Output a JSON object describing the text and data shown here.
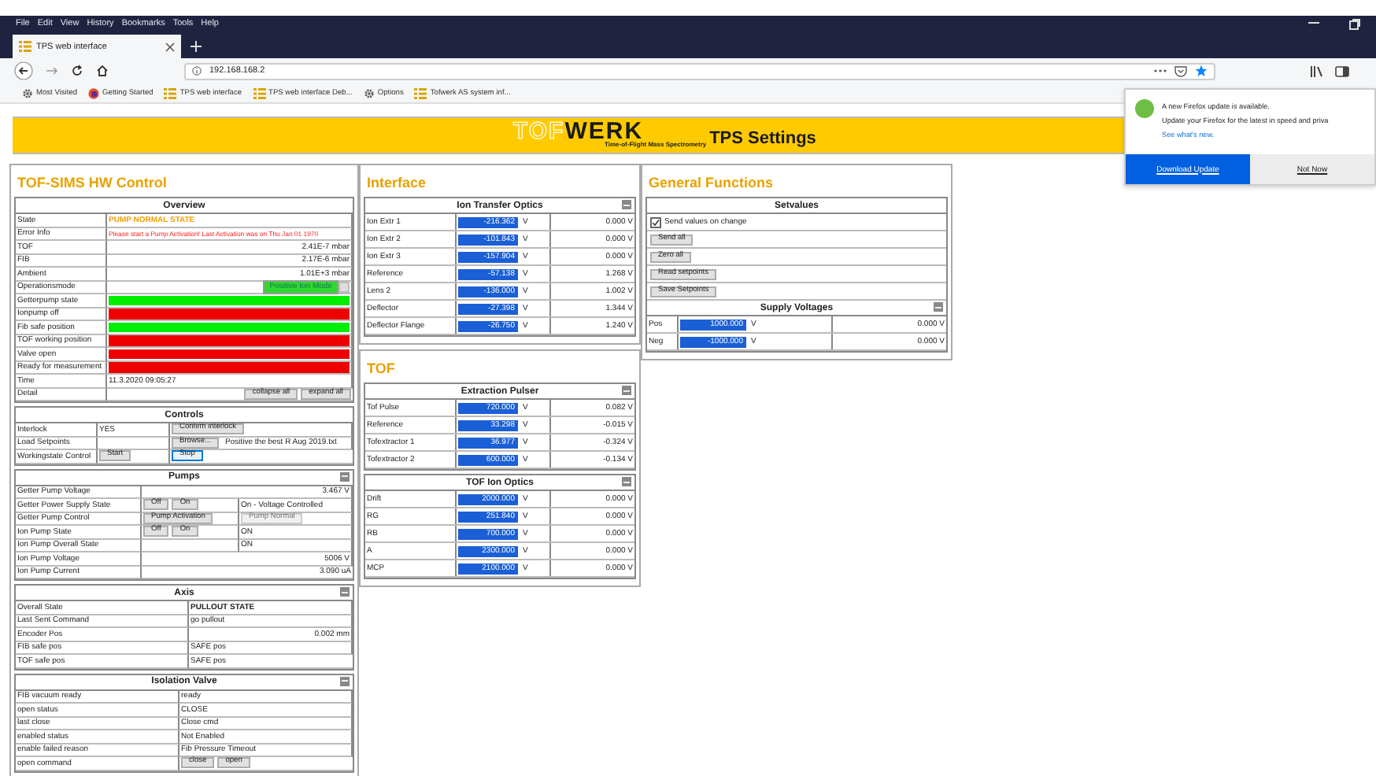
{
  "browser": {
    "menu": [
      "File",
      "Edit",
      "View",
      "History",
      "Bookmarks",
      "Tools",
      "Help"
    ],
    "tab": {
      "title": "TPS web interface"
    },
    "address": "192.168.168.2",
    "bookmarks": [
      {
        "label": "Most Visited",
        "kind": "gear"
      },
      {
        "label": "Getting Started",
        "kind": "globe"
      },
      {
        "label": "TPS web interface",
        "kind": "grid"
      },
      {
        "label": "TPS web interface Deb...",
        "kind": "grid"
      },
      {
        "label": "Options",
        "kind": "gear"
      },
      {
        "label": "Tofwerk AS system inf...",
        "kind": "grid"
      }
    ]
  },
  "banner": {
    "logo_outline": "TOF",
    "logo_bold": "WERK",
    "tagline": "Time-of-Flight Mass Spectrometry",
    "title": "TPS Settings"
  },
  "update_popup": {
    "heading": "A new Firefox update is available.",
    "message": "Update your Firefox for the latest in speed and priva",
    "link": "See what's new.",
    "buttons": [
      {
        "label": "Download Update",
        "kind": "primary"
      },
      {
        "label": "Not Now",
        "kind": "secondary"
      }
    ]
  },
  "control_panel": {
    "title": "TOF-SIMS HW Control",
    "sections": [
      {
        "title": "Overview",
        "kind": "overview",
        "collapsible": false,
        "rows": [
          {
            "label": "State",
            "cells": [
              {
                "kind": "warning-text",
                "text": "PUMP NORMAL STATE"
              }
            ]
          },
          {
            "label": "Error Info",
            "cells": [
              {
                "kind": "error-text",
                "text": "Please start a Pump Activation! Last Activation was on Thu Jan 01 1970"
              }
            ]
          },
          {
            "label": "TOF",
            "cells": [
              {
                "kind": "number",
                "text": "2.41E-7 mbar"
              }
            ]
          },
          {
            "label": "FIB",
            "cells": [
              {
                "kind": "number",
                "text": "2.17E-6 mbar"
              }
            ]
          },
          {
            "label": "Ambient",
            "cells": [
              {
                "kind": "number",
                "text": "1.01E+3 mbar"
              }
            ]
          },
          {
            "label": "Operationsmode",
            "cells": [
              {
                "kind": "select",
                "text": "Positive Ion Mode"
              }
            ]
          },
          {
            "label": "Getterpump state",
            "cells": [
              {
                "kind": "bar",
                "color": "#00ee00"
              }
            ]
          },
          {
            "label": "Ionpump off",
            "cells": [
              {
                "kind": "bar",
                "color": "#ee0000"
              }
            ]
          },
          {
            "label": "Fib safe position",
            "cells": [
              {
                "kind": "bar",
                "color": "#00ee00"
              }
            ]
          },
          {
            "label": "TOF working position",
            "cells": [
              {
                "kind": "bar",
                "color": "#ee0000"
              }
            ]
          },
          {
            "label": "Valve open",
            "cells": [
              {
                "kind": "bar",
                "color": "#ee0000"
              }
            ]
          },
          {
            "label": "Ready for measurement",
            "cells": [
              {
                "kind": "bar",
                "color": "#ee0000"
              }
            ]
          },
          {
            "label": "Time",
            "cells": [
              {
                "kind": "text",
                "text": "11.3.2020 09:05:27"
              }
            ]
          },
          {
            "label": "Detail",
            "cells": [
              {
                "kind": "buttons",
                "buttons": [
                  {
                    "label": "collapse all",
                    "disabled": false,
                    "focused": false
                  },
                  {
                    "label": "expand all",
                    "disabled": false,
                    "focused": false
                  }
                ]
              }
            ]
          }
        ]
      },
      {
        "title": "Controls",
        "kind": "controls",
        "collapsible": false,
        "rows": [
          {
            "label": "Interlock",
            "cells": [
              {
                "kind": "text",
                "text": "YES"
              },
              {
                "kind": "buttons",
                "buttons": [
                  {
                    "label": "Confirm interlock",
                    "disabled": false,
                    "focused": false
                  }
                ]
              }
            ]
          },
          {
            "label": "Load Setpoints",
            "cells": [
              {
                "kind": "blank"
              },
              {
                "kind": "file",
                "button": "Browse...",
                "text": "Positive the best R Aug 2019.txt"
              }
            ]
          },
          {
            "label": "Workingstate Control",
            "cells": [
              {
                "kind": "buttons",
                "buttons": [
                  {
                    "label": "Start",
                    "disabled": false,
                    "focused": false
                  }
                ]
              },
              {
                "kind": "buttons",
                "buttons": [
                  {
                    "label": "Stop",
                    "disabled": false,
                    "focused": true
                  }
                ]
              }
            ]
          }
        ]
      },
      {
        "title": "Pumps",
        "kind": "pumps",
        "collapsible": true,
        "rows": [
          {
            "label": "Getter Pump Voltage",
            "cells": [
              {
                "kind": "number",
                "text": "3.467 V"
              }
            ]
          },
          {
            "label": "Getter Power Supply State",
            "cells": [
              {
                "kind": "buttons",
                "buttons": [
                  {
                    "label": "Off",
                    "disabled": false,
                    "focused": false
                  },
                  {
                    "label": "On",
                    "disabled": false,
                    "focused": false
                  }
                ]
              },
              {
                "kind": "text",
                "text": "On - Voltage Controlled"
              }
            ]
          },
          {
            "label": "Getter Pump Control",
            "cells": [
              {
                "kind": "buttons",
                "buttons": [
                  {
                    "label": "Pump Activation",
                    "disabled": false,
                    "focused": false
                  }
                ]
              },
              {
                "kind": "buttons",
                "buttons": [
                  {
                    "label": "Pump Normal",
                    "disabled": true,
                    "focused": false
                  }
                ]
              }
            ]
          },
          {
            "label": "Ion Pump State",
            "cells": [
              {
                "kind": "buttons",
                "buttons": [
                  {
                    "label": "Off",
                    "disabled": false,
                    "focused": false
                  },
                  {
                    "label": "On",
                    "disabled": false,
                    "focused": false
                  }
                ]
              },
              {
                "kind": "text",
                "text": "ON"
              }
            ]
          },
          {
            "label": "Ion Pump Overall State",
            "cells": [
              {
                "kind": "blank"
              },
              {
                "kind": "text",
                "text": "ON"
              }
            ]
          },
          {
            "label": "Ion Pump Voltage",
            "cells": [
              {
                "kind": "number",
                "text": "5006 V"
              }
            ]
          },
          {
            "label": "Ion Pump Current",
            "cells": [
              {
                "kind": "number",
                "text": "3.090 uA"
              }
            ]
          }
        ]
      },
      {
        "title": "Axis",
        "kind": "axis",
        "collapsible": true,
        "rows": [
          {
            "label": "Overall State",
            "cells": [
              {
                "kind": "bold-text",
                "text": "PULLOUT STATE"
              }
            ]
          },
          {
            "label": "Last Sent Command",
            "cells": [
              {
                "kind": "text",
                "text": "go pullout"
              }
            ]
          },
          {
            "label": "Encoder Pos",
            "cells": [
              {
                "kind": "number",
                "text": "0.002 mm"
              }
            ]
          },
          {
            "label": "FIB safe pos",
            "cells": [
              {
                "kind": "text",
                "text": "SAFE pos"
              }
            ]
          },
          {
            "label": "TOF safe pos",
            "cells": [
              {
                "kind": "text",
                "text": "SAFE pos"
              }
            ]
          }
        ]
      },
      {
        "title": "Isolation Valve",
        "kind": "valve",
        "collapsible": true,
        "rows": [
          {
            "label": "FIB vacuum ready",
            "cells": [
              {
                "kind": "text",
                "text": "ready"
              }
            ]
          },
          {
            "label": "open status",
            "cells": [
              {
                "kind": "text",
                "text": "CLOSE"
              }
            ]
          },
          {
            "label": "last close",
            "cells": [
              {
                "kind": "text",
                "text": "Close cmd"
              }
            ]
          },
          {
            "label": "enabled status",
            "cells": [
              {
                "kind": "text",
                "text": "Not Enabled"
              }
            ]
          },
          {
            "label": "enable failed reason",
            "cells": [
              {
                "kind": "text",
                "text": "Fib Pressure Timeout"
              }
            ]
          },
          {
            "label": "open command",
            "cells": [
              {
                "kind": "buttons",
                "buttons": [
                  {
                    "label": "close",
                    "disabled": false,
                    "focused": false
                  },
                  {
                    "label": "open",
                    "disabled": false,
                    "focused": false
                  }
                ]
              }
            ]
          }
        ]
      }
    ]
  },
  "optics_panels": [
    {
      "title": "Interface",
      "groups": [
        {
          "title": "Ion Transfer Optics",
          "rows": [
            {
              "label": "Ion Extr 1",
              "setpoint": "-216.362",
              "unit": "V",
              "reading": "0.000 V"
            },
            {
              "label": "Ion Extr 2",
              "setpoint": "-101.843",
              "unit": "V",
              "reading": "0.000 V"
            },
            {
              "label": "Ion Extr 3",
              "setpoint": "-157.904",
              "unit": "V",
              "reading": "0.000 V"
            },
            {
              "label": "Reference",
              "setpoint": "-57.138",
              "unit": "V",
              "reading": "1.268 V"
            },
            {
              "label": "Lens 2",
              "setpoint": "-136.000",
              "unit": "V",
              "reading": "1.002 V"
            },
            {
              "label": "Deflector",
              "setpoint": "-27.398",
              "unit": "V",
              "reading": "1.344 V"
            },
            {
              "label": "Deflector Flange",
              "setpoint": "-26.750",
              "unit": "V",
              "reading": "1.240 V"
            }
          ]
        }
      ]
    },
    {
      "title": "TOF",
      "groups": [
        {
          "title": "Extraction Pulser",
          "rows": [
            {
              "label": "Tof Pulse",
              "setpoint": "720.000",
              "unit": "V",
              "reading": "0.082 V"
            },
            {
              "label": "Reference",
              "setpoint": "33.298",
              "unit": "V",
              "reading": "-0.015 V"
            },
            {
              "label": "Tofextractor 1",
              "setpoint": "36.977",
              "unit": "V",
              "reading": "-0.324 V"
            },
            {
              "label": "Tofextractor 2",
              "setpoint": "600.000",
              "unit": "V",
              "reading": "-0.134 V"
            }
          ]
        },
        {
          "title": "TOF Ion Optics",
          "rows": [
            {
              "label": "Drift",
              "setpoint": "2000.000",
              "unit": "V",
              "reading": "0.000 V"
            },
            {
              "label": "RG",
              "setpoint": "251.840",
              "unit": "V",
              "reading": "0.000 V"
            },
            {
              "label": "RB",
              "setpoint": "700.000",
              "unit": "V",
              "reading": "0.000 V"
            },
            {
              "label": "A",
              "setpoint": "2300.000",
              "unit": "V",
              "reading": "0.000 V"
            },
            {
              "label": "MCP",
              "setpoint": "2100.000",
              "unit": "V",
              "reading": "0.000 V"
            }
          ]
        }
      ]
    }
  ],
  "general_functions": {
    "title": "General Functions",
    "setvalues": {
      "title": "Setvalues",
      "checkbox": {
        "label": "Send values on change",
        "checked": true
      },
      "buttons": [
        "Send all",
        "Zero all",
        "Read setpoints",
        "Save Setpoints"
      ]
    },
    "supply": {
      "title": "Supply Voltages",
      "rows": [
        {
          "label": "Pos",
          "setpoint": "1000.000",
          "unit": "V",
          "reading": "0.000 V"
        },
        {
          "label": "Neg",
          "setpoint": "-1000.000",
          "unit": "V",
          "reading": "0.000 V"
        }
      ]
    }
  }
}
